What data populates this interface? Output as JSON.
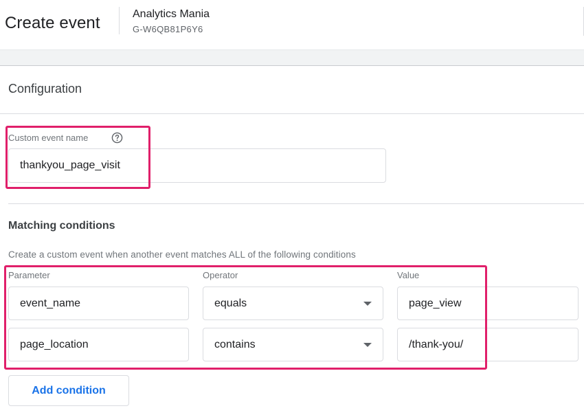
{
  "header": {
    "title": "Create event",
    "account_name": "Analytics Mania",
    "property_id": "G-W6QB81P6Y6"
  },
  "configuration": {
    "section_title": "Configuration",
    "custom_event_name_label": "Custom event name",
    "custom_event_name_value": "thankyou_page_visit",
    "help_icon": "help-circle-icon"
  },
  "matching": {
    "title": "Matching conditions",
    "hint": "Create a custom event when another event matches ALL of the following conditions",
    "columns": {
      "parameter": "Parameter",
      "operator": "Operator",
      "value": "Value"
    },
    "rows": [
      {
        "parameter": "event_name",
        "operator": "equals",
        "value": "page_view"
      },
      {
        "parameter": "page_location",
        "operator": "contains",
        "value": "/thank-you/"
      }
    ],
    "add_condition_label": "Add condition"
  },
  "colors": {
    "highlight": "#e01f6a",
    "accent": "#1a73e8"
  }
}
